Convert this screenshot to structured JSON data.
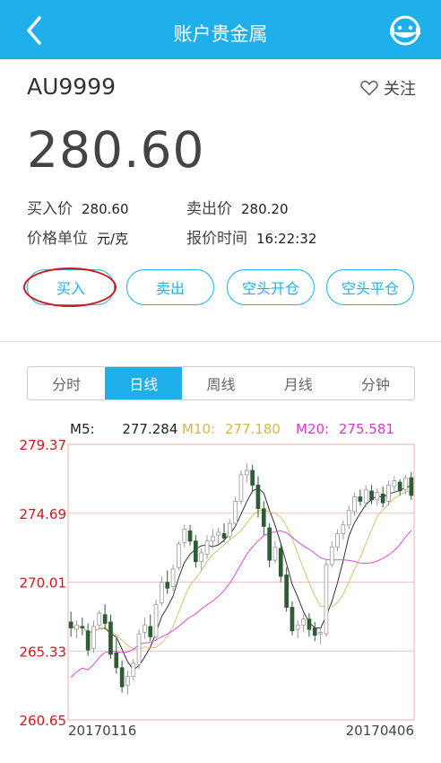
{
  "header": {
    "title": "账户贵金属",
    "back_icon": "chevron-left-icon",
    "service_icon": "customer-service-icon"
  },
  "instrument": {
    "symbol": "AU9999",
    "follow_label": "关注",
    "follow_icon": "heart-outline-icon",
    "price": "280.60"
  },
  "quote": {
    "buy_label": "买入价",
    "buy_value": "280.60",
    "sell_label": "卖出价",
    "sell_value": "280.20",
    "unit_label": "价格单位",
    "unit_value": "元/克",
    "time_label": "报价时间",
    "time_value": "16:22:32"
  },
  "actions": [
    "买入",
    "卖出",
    "空头开仓",
    "空头平仓"
  ],
  "period_tabs": {
    "items": [
      "分时",
      "日线",
      "周线",
      "月线",
      "分钟"
    ],
    "active": 1
  },
  "ma_legend": {
    "m5_label": "M5:",
    "m5_value": "277.284",
    "m10_label": "M10:",
    "m10_value": "277.180",
    "m20_label": "M20:",
    "m20_value": "275.581"
  },
  "colors": {
    "accent": "#1fb0ec",
    "up": "#ffffff",
    "down": "#2f5c35",
    "axis": "#cc1a1a",
    "m5": "#333333",
    "m10": "#d8c070",
    "m20": "#e04ad8"
  },
  "chart_data": {
    "type": "candlestick",
    "x_start": "20170116",
    "x_end": "20170406",
    "y_ticks": [
      "279.37",
      "274.69",
      "270.01",
      "265.33",
      "260.65"
    ],
    "ylim": [
      260.65,
      279.37
    ],
    "ohlc": [
      [
        267.3,
        268.0,
        266.3,
        266.9
      ],
      [
        266.8,
        267.4,
        266.2,
        267.1
      ],
      [
        267.0,
        267.6,
        266.4,
        266.9
      ],
      [
        266.7,
        267.2,
        265.0,
        265.4
      ],
      [
        265.5,
        267.4,
        265.2,
        267.0
      ],
      [
        267.1,
        268.1,
        266.8,
        267.9
      ],
      [
        267.8,
        268.5,
        266.8,
        267.2
      ],
      [
        267.3,
        267.8,
        264.8,
        265.1
      ],
      [
        265.2,
        266.2,
        263.8,
        264.2
      ],
      [
        264.2,
        264.7,
        262.5,
        262.9
      ],
      [
        263.0,
        264.0,
        262.4,
        263.6
      ],
      [
        263.6,
        264.8,
        263.3,
        264.5
      ],
      [
        264.4,
        266.8,
        264.1,
        266.5
      ],
      [
        266.6,
        267.6,
        266.2,
        267.1
      ],
      [
        267.0,
        267.8,
        266.0,
        266.3
      ],
      [
        266.3,
        268.8,
        266.1,
        268.5
      ],
      [
        268.6,
        270.4,
        268.4,
        270.0
      ],
      [
        270.0,
        270.8,
        269.2,
        269.6
      ],
      [
        269.7,
        271.2,
        269.4,
        270.9
      ],
      [
        271.0,
        272.8,
        270.8,
        272.6
      ],
      [
        272.7,
        273.9,
        272.4,
        273.6
      ],
      [
        273.5,
        273.9,
        272.5,
        272.8
      ],
      [
        272.8,
        273.2,
        271.0,
        271.4
      ],
      [
        271.4,
        272.3,
        270.8,
        272.0
      ],
      [
        271.9,
        273.2,
        271.6,
        272.8
      ],
      [
        272.8,
        273.6,
        272.3,
        273.1
      ],
      [
        273.2,
        273.7,
        272.6,
        273.4
      ],
      [
        273.3,
        274.0,
        272.7,
        273.0
      ],
      [
        273.1,
        274.3,
        272.9,
        274.0
      ],
      [
        274.0,
        275.8,
        273.8,
        275.5
      ],
      [
        275.5,
        277.6,
        275.3,
        277.3
      ],
      [
        277.3,
        278.1,
        276.8,
        277.6
      ],
      [
        277.6,
        278.0,
        276.2,
        276.6
      ],
      [
        276.6,
        277.2,
        274.4,
        275.0
      ],
      [
        275.0,
        275.5,
        273.2,
        273.8
      ],
      [
        273.7,
        274.0,
        271.0,
        271.5
      ],
      [
        271.5,
        272.8,
        271.3,
        272.4
      ],
      [
        272.3,
        272.6,
        270.0,
        270.4
      ],
      [
        270.5,
        271.0,
        268.0,
        268.3
      ],
      [
        268.3,
        268.7,
        266.4,
        266.7
      ],
      [
        266.8,
        267.4,
        266.2,
        267.1
      ],
      [
        267.1,
        267.8,
        266.6,
        267.5
      ],
      [
        267.5,
        267.9,
        266.3,
        266.8
      ],
      [
        266.9,
        267.3,
        266.0,
        266.4
      ],
      [
        266.5,
        266.9,
        265.8,
        266.6
      ],
      [
        266.5,
        271.5,
        266.3,
        271.2
      ],
      [
        271.2,
        272.8,
        271.0,
        272.4
      ],
      [
        272.4,
        273.6,
        272.1,
        273.3
      ],
      [
        273.3,
        274.2,
        272.9,
        273.9
      ],
      [
        273.9,
        275.2,
        273.6,
        274.9
      ],
      [
        274.8,
        276.1,
        274.5,
        275.8
      ],
      [
        275.8,
        276.3,
        275.2,
        275.5
      ],
      [
        275.4,
        276.6,
        275.1,
        276.3
      ],
      [
        276.2,
        276.6,
        275.3,
        275.6
      ],
      [
        275.6,
        276.4,
        275.2,
        276.1
      ],
      [
        276.0,
        276.5,
        275.1,
        275.4
      ],
      [
        275.5,
        276.9,
        275.2,
        276.6
      ],
      [
        276.5,
        277.2,
        276.2,
        276.9
      ],
      [
        276.8,
        277.0,
        275.9,
        276.2
      ],
      [
        276.3,
        277.3,
        276.0,
        277.1
      ],
      [
        277.1,
        277.5,
        275.6,
        275.9
      ]
    ],
    "series": [
      {
        "name": "M5",
        "values": []
      },
      {
        "name": "M10",
        "values": []
      },
      {
        "name": "M20",
        "values": []
      }
    ]
  }
}
